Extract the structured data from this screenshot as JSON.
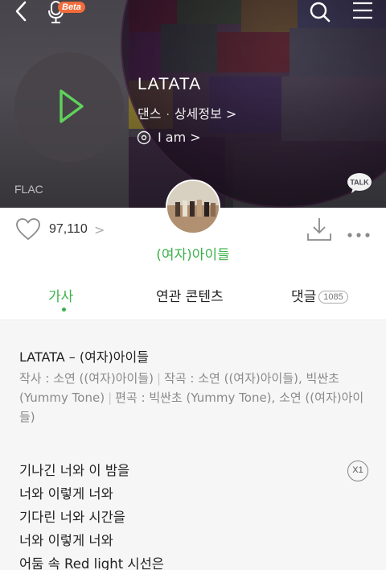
{
  "header": {
    "beta_label": "Beta"
  },
  "song": {
    "title": "LATATA",
    "genre": "댄스",
    "detail_link": "상세정보 >",
    "album": "I am >",
    "format": "FLAC",
    "artist": "(여자)아이들"
  },
  "stats": {
    "likes": "97,110",
    "likes_chevron": ">"
  },
  "tabs": [
    {
      "label": "가사",
      "active": true
    },
    {
      "label": "연관 콘텐츠",
      "active": false
    },
    {
      "label": "댓글",
      "count": "1085",
      "active": false
    }
  ],
  "lyrics": {
    "heading": "LATATA – (여자)아이들",
    "credits": {
      "lyricist": "작사 : 소연 ((여자)아이들)",
      "composer": "작곡 : 소연 ((여자)아이들), 빅싼초 (Yummy Tone)",
      "arranger": "편곡 : 빅싼초 (Yummy Tone), 소연 ((여자)아이들)"
    },
    "speed_label": "X1",
    "lines": [
      "기나긴 너와 이 밤을",
      "너와 이렇게 너와",
      "기다린 너와 시간을",
      "너와 이렇게 너와",
      "어둠 속 Red light 시선은"
    ]
  },
  "colors": {
    "accent": "#3cb24a",
    "hero_bg": "#4a4650",
    "lyrics_bg": "#f6f6f6",
    "beta_badge": "#f26b3a"
  },
  "icons": [
    "back-icon",
    "mic-icon",
    "search-icon",
    "hamburger-menu-icon",
    "play-icon",
    "album-disc-icon",
    "kakao-talk-icon",
    "heart-icon",
    "download-icon",
    "more-icon"
  ]
}
